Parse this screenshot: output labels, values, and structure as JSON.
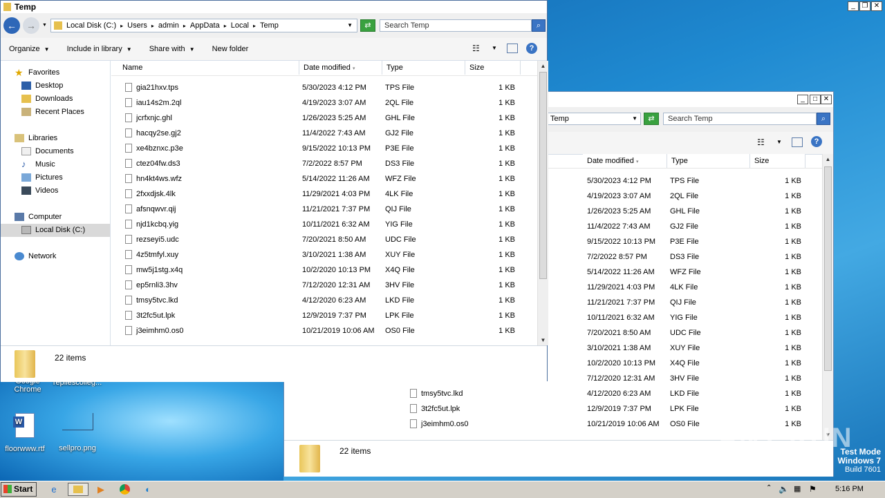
{
  "colors": {
    "accent": "#3a74c4",
    "go": "#39a13f",
    "desktop": "#1f8ad1"
  },
  "desktop": {
    "icons": [
      {
        "label": "Google Chrome"
      },
      {
        "label": "repliescolleg..."
      },
      {
        "label": "floorwww.rtf"
      },
      {
        "label": "sellpro.png"
      }
    ],
    "watermark": {
      "brand": "ANY RUN",
      "line1": "Test Mode",
      "line2": "Windows 7",
      "line3": "Build 7601"
    }
  },
  "front": {
    "title": "Temp",
    "breadcrumb": [
      "Local Disk (C:)",
      "Users",
      "admin",
      "AppData",
      "Local",
      "Temp"
    ],
    "search_placeholder": "Search Temp",
    "commands": [
      "Organize",
      "Include in library",
      "Share with",
      "New folder"
    ],
    "nav": {
      "favorites": "Favorites",
      "favorites_items": [
        "Desktop",
        "Downloads",
        "Recent Places"
      ],
      "libraries": "Libraries",
      "libraries_items": [
        "Documents",
        "Music",
        "Pictures",
        "Videos"
      ],
      "computer": "Computer",
      "computer_items": [
        "Local Disk (C:)"
      ],
      "network": "Network"
    },
    "columns": [
      "Name",
      "Date modified",
      "Type",
      "Size"
    ],
    "status": "22 items"
  },
  "back": {
    "breadcrumb_tail": "Temp",
    "search_placeholder": "Search Temp",
    "columns": [
      "Date modified",
      "Type",
      "Size"
    ],
    "status": "22 items"
  },
  "files": [
    {
      "name": "gia21hxv.tps",
      "date": "5/30/2023 4:12 PM",
      "type": "TPS File",
      "size": "1 KB"
    },
    {
      "name": "iau14s2m.2ql",
      "date": "4/19/2023 3:07 AM",
      "type": "2QL File",
      "size": "1 KB"
    },
    {
      "name": "jcrfxnjc.ghl",
      "date": "1/26/2023 5:25 AM",
      "type": "GHL File",
      "size": "1 KB"
    },
    {
      "name": "hacqy2se.gj2",
      "date": "11/4/2022 7:43 AM",
      "type": "GJ2 File",
      "size": "1 KB"
    },
    {
      "name": "xe4bznxc.p3e",
      "date": "9/15/2022 10:13 PM",
      "type": "P3E File",
      "size": "1 KB"
    },
    {
      "name": "ctez04fw.ds3",
      "date": "7/2/2022 8:57 PM",
      "type": "DS3 File",
      "size": "1 KB"
    },
    {
      "name": "hn4kt4ws.wfz",
      "date": "5/14/2022 11:26 AM",
      "type": "WFZ File",
      "size": "1 KB"
    },
    {
      "name": "2fxxdjsk.4lk",
      "date": "11/29/2021 4:03 PM",
      "type": "4LK File",
      "size": "1 KB"
    },
    {
      "name": "afsnqwvr.qij",
      "date": "11/21/2021 7:37 PM",
      "type": "QIJ File",
      "size": "1 KB"
    },
    {
      "name": "njd1kcbq.yig",
      "date": "10/11/2021 6:32 AM",
      "type": "YIG File",
      "size": "1 KB"
    },
    {
      "name": "rezseyi5.udc",
      "date": "7/20/2021 8:50 AM",
      "type": "UDC File",
      "size": "1 KB"
    },
    {
      "name": "4z5tmfyl.xuy",
      "date": "3/10/2021 1:38 AM",
      "type": "XUY File",
      "size": "1 KB"
    },
    {
      "name": "mw5j1stg.x4q",
      "date": "10/2/2020 10:13 PM",
      "type": "X4Q File",
      "size": "1 KB"
    },
    {
      "name": "ep5rnli3.3hv",
      "date": "7/12/2020 12:31 AM",
      "type": "3HV File",
      "size": "1 KB"
    },
    {
      "name": "tmsy5tvc.lkd",
      "date": "4/12/2020 6:23 AM",
      "type": "LKD File",
      "size": "1 KB"
    },
    {
      "name": "3t2fc5ut.lpk",
      "date": "12/9/2019 7:37 PM",
      "type": "LPK File",
      "size": "1 KB"
    },
    {
      "name": "j3eimhm0.os0",
      "date": "10/21/2019 10:06 AM",
      "type": "OS0 File",
      "size": "1 KB"
    }
  ],
  "taskbar": {
    "start": "Start",
    "clock": "5:16 PM"
  }
}
